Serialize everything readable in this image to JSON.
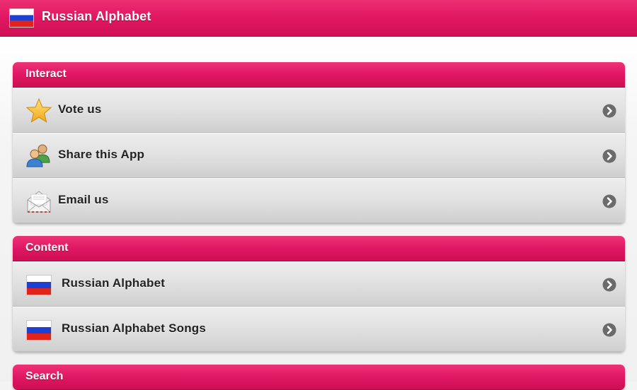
{
  "app": {
    "title": "Russian Alphabet"
  },
  "sections": [
    {
      "header": "Interact",
      "items": [
        {
          "label": "Vote us",
          "icon": "star-icon"
        },
        {
          "label": "Share this App",
          "icon": "users-icon"
        },
        {
          "label": "Email us",
          "icon": "envelope-icon"
        }
      ]
    },
    {
      "header": "Content",
      "items": [
        {
          "label": "Russian Alphabet",
          "icon": "russian-flag-icon"
        },
        {
          "label": "Russian Alphabet Songs",
          "icon": "russian-flag-icon"
        }
      ]
    },
    {
      "header": "Search",
      "items": []
    }
  ],
  "colors": {
    "accent": "#e01763",
    "row_gray": "#e2e2e2",
    "chevron": "#6b6b6b",
    "flag_white": "#ffffff",
    "flag_blue": "#1f3fd1",
    "flag_red": "#e2231a"
  }
}
